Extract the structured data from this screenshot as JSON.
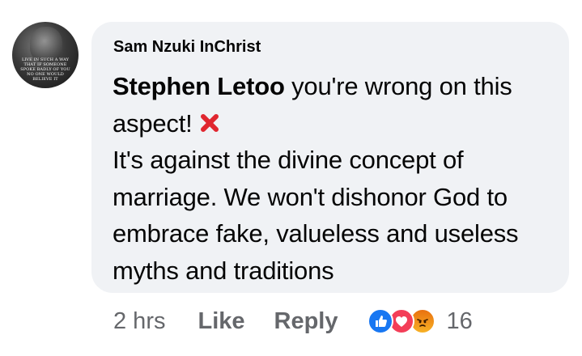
{
  "comment": {
    "author": "Sam Nzuki InChrist",
    "avatar_caption": "LIVE IN SUCH A WAY THAT IF SOMEONE SPOKE BADLY OF YOU NO ONE WOULD BELIEVE IT",
    "mention": "Stephen Letoo",
    "line1_rest": " you're wrong on this aspect!",
    "paragraph2": "It's against the divine concept of marriage. We won't dishonor God to embrace fake, valueless and useless myths and traditions",
    "emoji_icon": "cross-mark-icon"
  },
  "actions": {
    "time": "2 hrs",
    "like_label": "Like",
    "reply_label": "Reply",
    "reaction_icons": [
      "like-reaction-icon",
      "love-reaction-icon",
      "angry-reaction-icon"
    ],
    "reaction_count": "16"
  },
  "colors": {
    "bubble_bg": "#f0f2f5",
    "text": "#050505",
    "secondary_text": "#65676b",
    "like_blue": "#1877f2",
    "love_red": "#f33e58",
    "angry_orange": "#e9710f",
    "cross_red": "#e0262f"
  }
}
